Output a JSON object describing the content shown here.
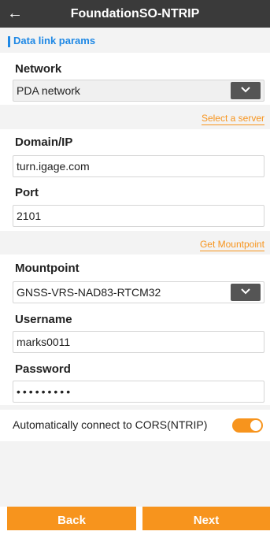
{
  "header": {
    "title": "FoundationSO-NTRIP"
  },
  "section": {
    "title": "Data link params"
  },
  "network": {
    "label": "Network",
    "value": "PDA network",
    "link": "Select a server"
  },
  "domain": {
    "label": "Domain/IP",
    "value": "turn.igage.com"
  },
  "port": {
    "label": "Port",
    "value": "2101",
    "link": "Get Mountpoint"
  },
  "mountpoint": {
    "label": "Mountpoint",
    "value": "GNSS-VRS-NAD83-RTCM32"
  },
  "username": {
    "label": "Username",
    "value": "marks0011"
  },
  "password": {
    "label": "Password",
    "value": "•••••••••"
  },
  "auto_connect": {
    "label": "Automatically connect to CORS(NTRIP)",
    "enabled": true
  },
  "footer": {
    "back_label": "Back",
    "next_label": "Next"
  },
  "colors": {
    "accent": "#f7941d",
    "header_bg": "#3a3a3a",
    "section_blue": "#1e88e5"
  }
}
